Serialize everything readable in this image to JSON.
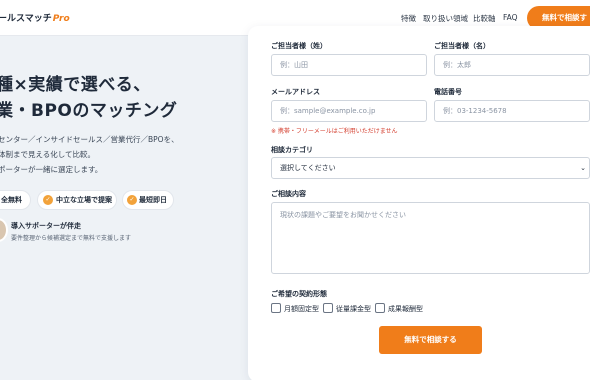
{
  "header": {
    "logo_text": "ールスマッチ",
    "logo_suffix": "Pro",
    "nav": [
      "特徴",
      "取り扱い領域",
      "比較軸",
      "FAQ"
    ],
    "cta_label": "無料で相談す"
  },
  "hero": {
    "title_line1": "種×実績で選べる、",
    "title_line2": "業・BPOのマッチング",
    "desc_line1": "センター／インサイドセールス／営業代行／BPOを、",
    "desc_line2": "体制まで見える化して比較。",
    "desc_line3": "ポーターが一緒に選定します。",
    "badges": [
      "全無料",
      "中立な立場で提案",
      "最短即日"
    ],
    "supporter_title": "導入サポーターが伴走",
    "supporter_sub": "要件整理から候補選定まで無料で支援します"
  },
  "form": {
    "person_label": "ご担当者様（姓）",
    "person_placeholder": "例：山田",
    "first_label": "ご担当者様（名）",
    "first_placeholder": "例：太郎",
    "email_label": "メールアドレス",
    "email_placeholder": "例：sample@example.co.jp",
    "phone_label": "電話番号",
    "phone_placeholder": "例：03-1234-5678",
    "email_note": "※ 携帯・フリーメールはご利用いただけません",
    "category_label": "相談カテゴリ",
    "category_selected": "選択してください",
    "content_label": "ご相談内容",
    "content_placeholder": "現状の課題やご要望をお聞かせください",
    "contract_label": "ご希望の契約形態",
    "contract_options": [
      "月額固定型",
      "従量課金型",
      "成果報酬型"
    ],
    "submit_label": "無料で相談する"
  }
}
